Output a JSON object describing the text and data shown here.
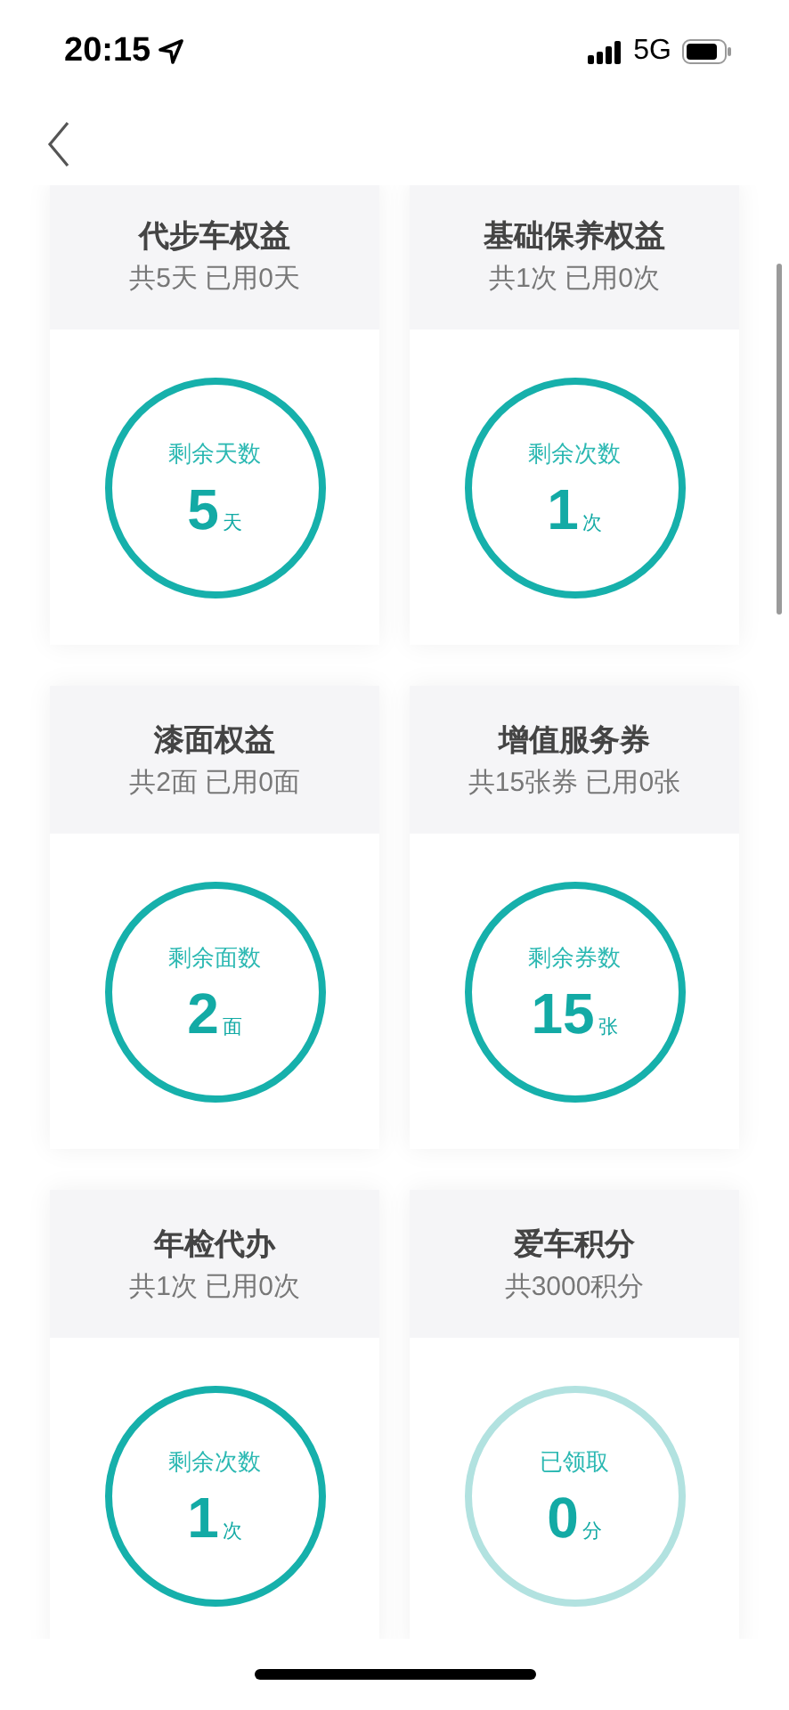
{
  "status_bar": {
    "time": "20:15",
    "network": "5G"
  },
  "cards": [
    {
      "title": "代步车权益",
      "summary": "共5天 已用0天",
      "label": "剩余天数",
      "value": "5",
      "unit": "天",
      "claimed": false
    },
    {
      "title": "基础保养权益",
      "summary": "共1次 已用0次",
      "label": "剩余次数",
      "value": "1",
      "unit": "次",
      "claimed": false
    },
    {
      "title": "漆面权益",
      "summary": "共2面 已用0面",
      "label": "剩余面数",
      "value": "2",
      "unit": "面",
      "claimed": false
    },
    {
      "title": "增值服务券",
      "summary": "共15张券 已用0张",
      "label": "剩余券数",
      "value": "15",
      "unit": "张",
      "claimed": false
    },
    {
      "title": "年检代办",
      "summary": "共1次 已用0次",
      "label": "剩余次数",
      "value": "1",
      "unit": "次",
      "claimed": false
    },
    {
      "title": "爱车积分",
      "summary": "共3000积分",
      "label": "已领取",
      "value": "0",
      "unit": "分",
      "claimed": true
    }
  ]
}
